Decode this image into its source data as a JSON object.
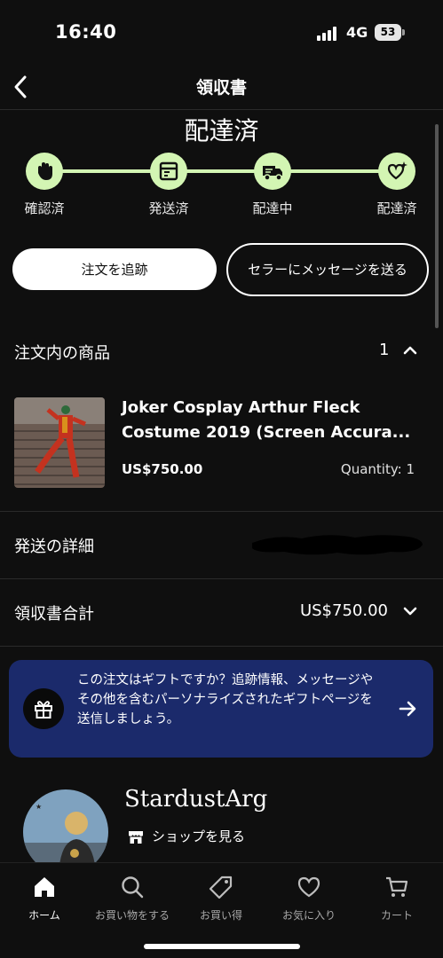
{
  "status_bar": {
    "time": "16:40",
    "network": "4G",
    "battery": "53"
  },
  "header": {
    "title": "領収書",
    "back_icon": "chevron-left-icon"
  },
  "delivery": {
    "status": "配達済",
    "steps": [
      {
        "label": "確認済",
        "icon": "wave-hand-icon"
      },
      {
        "label": "発送済",
        "icon": "package-icon"
      },
      {
        "label": "配達中",
        "icon": "truck-icon"
      },
      {
        "label": "配達済",
        "icon": "heart-sparkle-icon"
      }
    ],
    "progress": 1.0,
    "accent_color": "#d3f5b3"
  },
  "actions": {
    "track_order": "注文を追跡",
    "message_seller": "セラーにメッセージを送る"
  },
  "order_items": {
    "title": "注文内の商品",
    "count": "1",
    "items": [
      {
        "name": "Joker Cosplay Arthur Fleck Costume 2019 (Screen Accura...",
        "price": "US$750.00",
        "quantity": "Quantity: 1"
      }
    ]
  },
  "shipping": {
    "title": "発送の詳細"
  },
  "receipt_total": {
    "title": "領収書合計",
    "amount": "US$750.00"
  },
  "gift_promo": {
    "text": "この注文はギフトですか？追跡情報、メッセージやその他を含むパーソナライズされたギフトページを送信しましょう。",
    "background": "#1b2a6b"
  },
  "shop": {
    "name": "StardustArg",
    "link": "ショップを見る"
  },
  "tab_bar": {
    "tabs": [
      {
        "label": "ホーム",
        "icon": "home-icon",
        "active": true
      },
      {
        "label": "お買い物をする",
        "icon": "search-icon",
        "active": false
      },
      {
        "label": "お買い得",
        "icon": "tag-icon",
        "active": false
      },
      {
        "label": "お気に入り",
        "icon": "heart-icon",
        "active": false
      },
      {
        "label": "カート",
        "icon": "cart-icon",
        "active": false
      }
    ]
  }
}
